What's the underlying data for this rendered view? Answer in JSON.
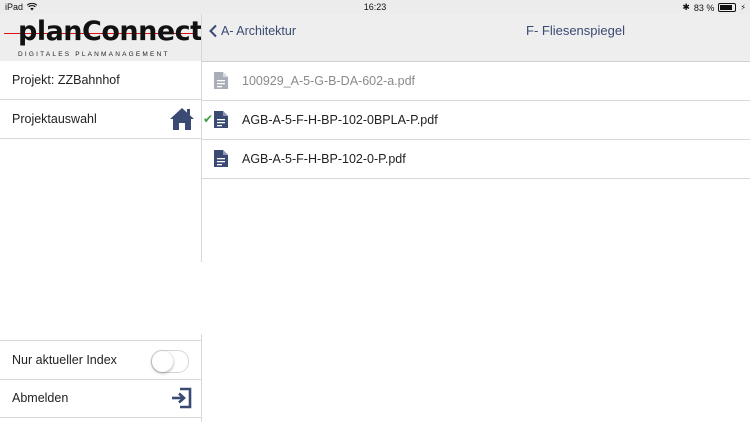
{
  "statusbar": {
    "device": "iPad",
    "time": "16:23",
    "battery_text": "83 %",
    "battery_level": 0.83
  },
  "logo": {
    "brand": "planConnect",
    "tagline": "DIGITALES PLANMANAGEMENT",
    "brand_color": "#d11111"
  },
  "sidebar": {
    "project": "Projekt: ZZBahnhof",
    "project_select": "Projektauswahl",
    "project_select_icon": "home-icon",
    "current_index": "Nur aktueller Index",
    "current_index_on": false,
    "logout": "Abmelden",
    "logout_icon": "logout-icon"
  },
  "navbar": {
    "back_label": "A- Architektur",
    "title": "F- Fliesenspiegel",
    "accent": "#3a4a73"
  },
  "files": [
    {
      "name": "100929_A-5-G-B-DA-602-a.pdf",
      "checked": false,
      "dimmed": true
    },
    {
      "name": "AGB-A-5-F-H-BP-102-0BPLA-P.pdf",
      "checked": true,
      "dimmed": false
    },
    {
      "name": "AGB-A-5-F-H-BP-102-0-P.pdf",
      "checked": false,
      "dimmed": false
    }
  ]
}
